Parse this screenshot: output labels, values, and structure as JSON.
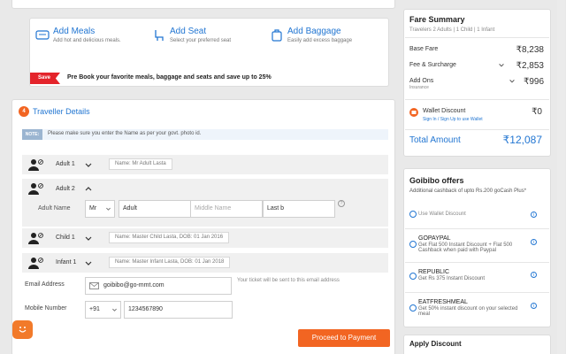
{
  "addons": {
    "meals": {
      "title": "Add Meals",
      "sub": "Add hot and delicious meals."
    },
    "seat": {
      "title": "Add Seat",
      "sub": "Select your preferred seat"
    },
    "baggage": {
      "title": "Add Baggage",
      "sub": "Easily add excess baggage"
    },
    "save_badge": "Save",
    "banner": "Pre Book your favorite meals, baggage and seats and save up to 25%"
  },
  "traveller": {
    "step": "4",
    "title": "Traveller Details",
    "note_badge": "NOTE:",
    "note_text": "Please make sure you enter the Name as per your govt. photo id.",
    "rows": [
      {
        "label": "Adult 1",
        "tag": "Name: Mr Adult Lasta"
      },
      {
        "label": "Adult 2"
      },
      {
        "label": "Child 1",
        "tag": "Name: Master Child Lasta, DOB: 01 Jan 2016"
      },
      {
        "label": "Infant 1",
        "tag": "Name: Master Infant Lasta, DOB: 01 Jan 2018"
      }
    ],
    "name_label": "Adult Name",
    "title_value": "Mr",
    "first_value": "Adult",
    "middle_placeholder": "Middle Name",
    "last_value": "Last b",
    "help": "?",
    "email_label": "Email Address",
    "email_value": "goibibo@go-mmt.com",
    "email_hint": "Your ticket will be sent to this email address",
    "mobile_label": "Mobile Number",
    "country_code": "+91",
    "mobile_value": "1234567890",
    "proceed": "Proceed to Payment"
  },
  "fare": {
    "title": "Fare Summary",
    "sub": "Travelers 2 Adults | 1 Child | 1 Infant",
    "base_label": "Base Fare",
    "base_amt": "₹8,238",
    "fee_label": "Fee & Surcharge",
    "fee_amt": "₹2,853",
    "addons_label": "Add Ons",
    "addons_sub": "Insurance",
    "addons_amt": "₹996",
    "wallet_label": "Wallet Discount",
    "wallet_link": "Sign In / Sign Up to use Wallet",
    "wallet_amt": "₹0",
    "total_label": "Total Amount",
    "total_amt": "₹12,087"
  },
  "offers": {
    "title": "Goibibo offers",
    "sub": "Additional cashback of upto Rs.200 goCash Plus*",
    "items": [
      {
        "code": "Use Wallet Discount"
      },
      {
        "code": "GOPAYPAL",
        "desc": "Get Flat 500 Instant Discount + Flat 500 Cashback when paid with Paypal"
      },
      {
        "code": "REPUBLIC",
        "desc": "Get Rs 375 Instant Discount"
      },
      {
        "code": "EATFRESHMEAL",
        "desc": "Get 50% instant discount on your selected meal"
      }
    ]
  },
  "apply": {
    "title": "Apply Discount"
  },
  "colors": {
    "accent": "#2276d2",
    "cta": "#f26522",
    "save": "#e4242b",
    "bg": "#e9e9e9"
  }
}
